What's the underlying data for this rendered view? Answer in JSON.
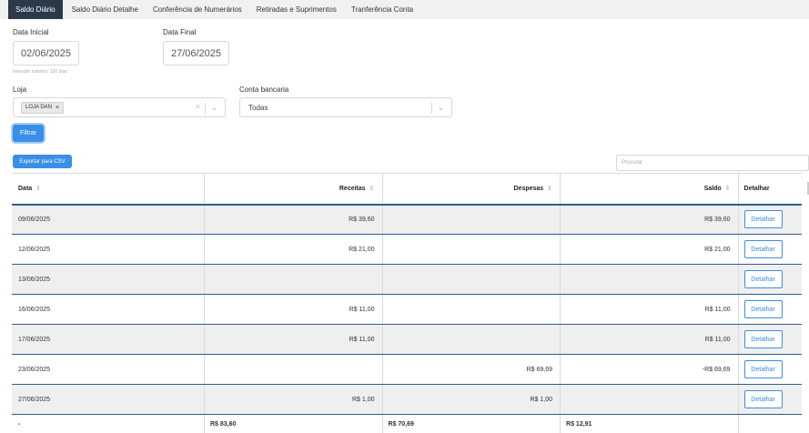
{
  "tabs": [
    {
      "label": "Saldo Diário",
      "active": true
    },
    {
      "label": "Saldo Diário Detalhe",
      "active": false
    },
    {
      "label": "Conferência de Numerários",
      "active": false
    },
    {
      "label": "Retiradas e Suprimentos",
      "active": false
    },
    {
      "label": "Tranferência Conta",
      "active": false
    }
  ],
  "filters": {
    "start_label": "Data Inicial",
    "start_value": "02/06/2025",
    "end_label": "Data Final",
    "end_value": "27/06/2025",
    "hint": "Intervalo máximo: 120 dias",
    "store_label": "Loja",
    "store_chip": "LOJA DAN",
    "store_chip_remove": "×",
    "store_clear": "×",
    "account_label": "Conta bancaria",
    "account_value": "Todas",
    "filter_button": "Filtrar"
  },
  "export_button": "Exportar para CSV",
  "search": {
    "placeholder": "Procurar"
  },
  "table": {
    "headers": {
      "date": "Data",
      "revenue": "Receitas",
      "expenses": "Despesas",
      "balance": "Saldo",
      "detail": "Detalhar"
    },
    "sort_icon": "⇕",
    "chevron": "⌄",
    "detail_button": "Detalhar",
    "rows": [
      {
        "date": "09/06/2025",
        "revenue": "R$ 39,60",
        "expenses": "",
        "balance": "R$ 39,60"
      },
      {
        "date": "12/06/2025",
        "revenue": "R$ 21,00",
        "expenses": "",
        "balance": "R$ 21,00"
      },
      {
        "date": "13/06/2025",
        "revenue": "",
        "expenses": "",
        "balance": ""
      },
      {
        "date": "16/06/2025",
        "revenue": "R$ 11,00",
        "expenses": "",
        "balance": "R$ 11,00"
      },
      {
        "date": "17/06/2025",
        "revenue": "R$ 11,00",
        "expenses": "",
        "balance": "R$ 11,00"
      },
      {
        "date": "23/06/2025",
        "revenue": "",
        "expenses": "R$ 69,69",
        "balance": "-R$ 69,69"
      },
      {
        "date": "27/06/2025",
        "revenue": "R$ 1,00",
        "expenses": "R$ 1,00",
        "balance": ""
      }
    ],
    "footer": {
      "date": "-",
      "revenue": "R$ 83,60",
      "expenses": "R$ 70,69",
      "balance": "R$ 12,91",
      "detail": ""
    }
  },
  "colors": {
    "accent": "#3a8ee6",
    "tab_active": "#2b3a4b",
    "row_border": "#2f5d93"
  }
}
